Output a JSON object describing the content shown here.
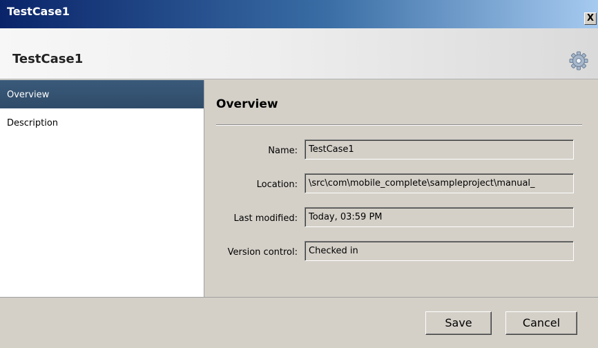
{
  "window": {
    "title": "TestCase1",
    "close_label": "X"
  },
  "header": {
    "title": "TestCase1",
    "icon": "gear-icon"
  },
  "nav": {
    "items": [
      {
        "label": "Overview",
        "selected": true
      },
      {
        "label": "Description",
        "selected": false
      }
    ]
  },
  "content": {
    "section_title": "Overview",
    "fields": [
      {
        "label": "Name:",
        "value": "TestCase1"
      },
      {
        "label": "Location:",
        "value": "\\src\\com\\mobile_complete\\sampleproject\\manual_"
      },
      {
        "label": "Last modified:",
        "value": "Today, 03:59 PM"
      },
      {
        "label": "Version control:",
        "value": "Checked in"
      }
    ]
  },
  "footer": {
    "save_label": "Save",
    "cancel_label": "Cancel"
  },
  "colors": {
    "titlebar_start": "#0a246a",
    "selection": "#2f4b69",
    "panel": "#d4d0c8"
  }
}
